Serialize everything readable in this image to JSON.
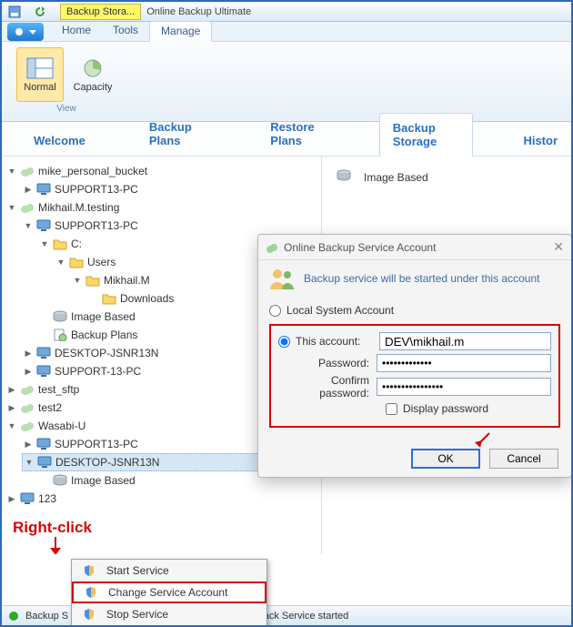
{
  "colors": {
    "accent": "#2a70bf",
    "danger": "#d40808"
  },
  "titlebar": {
    "doc_tab": "Backup Stora...",
    "app_title": "Online Backup Ultimate"
  },
  "ribbon": {
    "tabs": [
      "Home",
      "Tools",
      "Manage"
    ],
    "active_tab": "Manage",
    "group": {
      "name": "View",
      "buttons": [
        {
          "label": "Normal",
          "active": true,
          "icon": "panels-icon"
        },
        {
          "label": "Capacity",
          "active": false,
          "icon": "chart-icon"
        }
      ]
    }
  },
  "subtabs": {
    "items": [
      "Welcome",
      "Backup Plans",
      "Restore Plans",
      "Backup Storage",
      "Histor"
    ],
    "active": "Backup Storage"
  },
  "tree": [
    {
      "icon": "cloud-icon",
      "label": "mike_personal_bucket",
      "open": true,
      "children": [
        {
          "icon": "monitor-icon",
          "label": "SUPPORT13-PC",
          "open": false
        }
      ]
    },
    {
      "icon": "cloud-icon",
      "label": "Mikhail.M.testing",
      "open": true,
      "children": [
        {
          "icon": "monitor-icon",
          "label": "SUPPORT13-PC",
          "open": true,
          "children": [
            {
              "icon": "folder-icon",
              "label": "C:",
              "open": true,
              "children": [
                {
                  "icon": "folder-icon",
                  "label": "Users",
                  "open": true,
                  "children": [
                    {
                      "icon": "folder-icon",
                      "label": "Mikhail.M",
                      "open": true,
                      "children": [
                        {
                          "icon": "folder-icon",
                          "label": "Downloads",
                          "leaf": true
                        }
                      ]
                    }
                  ]
                }
              ]
            },
            {
              "icon": "disk-icon",
              "label": "Image Based",
              "leaf": true
            },
            {
              "icon": "plan-icon",
              "label": "Backup Plans",
              "leaf": true
            }
          ]
        },
        {
          "icon": "monitor-icon",
          "label": "DESKTOP-JSNR13N",
          "open": false
        },
        {
          "icon": "monitor-icon",
          "label": "SUPPORT-13-PC",
          "open": false
        }
      ]
    },
    {
      "icon": "cloud-icon",
      "label": "test_sftp",
      "open": false
    },
    {
      "icon": "cloud-icon",
      "label": "test2",
      "open": false
    },
    {
      "icon": "cloud-icon",
      "label": "Wasabi-U",
      "open": true,
      "children": [
        {
          "icon": "monitor-icon",
          "label": "SUPPORT13-PC",
          "open": false
        },
        {
          "icon": "monitor-icon",
          "label": "DESKTOP-JSNR13N",
          "open": true,
          "selected": true,
          "children": [
            {
              "icon": "disk-icon",
              "label": "Image Based",
              "leaf": true
            }
          ]
        }
      ]
    },
    {
      "icon": "monitor-icon",
      "label": "123",
      "open": false
    }
  ],
  "content": {
    "items": [
      {
        "icon": "disk-icon",
        "label": "Image Based"
      }
    ]
  },
  "annotation": {
    "text": "Right-click"
  },
  "status": {
    "items": [
      "Backup S",
      "",
      "Support Pack Service started"
    ]
  },
  "context_menu": {
    "items": [
      {
        "icon": "shield-icon",
        "label": "Start Service"
      },
      {
        "icon": "shield-icon",
        "label": "Change Service Account",
        "highlight": true
      },
      {
        "icon": "shield-icon",
        "label": "Stop Service"
      }
    ]
  },
  "dialog": {
    "title": "Online Backup Service Account",
    "subtitle": "Backup service will be started under this account",
    "opt_local": "Local System Account",
    "opt_this": "This account:",
    "account_value": "DEV\\mikhail.m",
    "lbl_password": "Password:",
    "lbl_confirm": "Confirm password:",
    "pwd_value": "•••••••••••••",
    "confirm_value": "••••••••••••••••",
    "chk_display": "Display password",
    "btn_ok": "OK",
    "btn_cancel": "Cancel"
  }
}
